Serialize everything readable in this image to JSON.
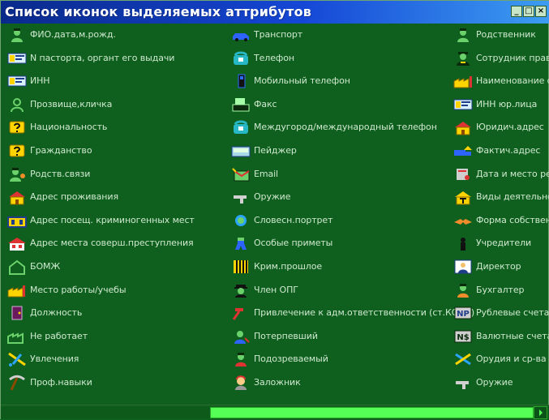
{
  "window": {
    "title": "Список иконок выделяемых аттрибутов",
    "buttons": {
      "minimize": "_",
      "maximize": "□",
      "close": "×"
    }
  },
  "columns": [
    {
      "items": [
        {
          "label": "ФИО.дата,м.рожд.",
          "icon": "person-icon"
        },
        {
          "label": "N пастopта, оргaнт его выдачи",
          "icon": "id-card-icon"
        },
        {
          "label": "ИНН",
          "icon": "id-card-icon"
        },
        {
          "label": "Прозвище,кличка",
          "icon": "person-outline-icon"
        },
        {
          "label": "Национальность",
          "icon": "question-icon"
        },
        {
          "label": "Гражданство",
          "icon": "question-icon"
        },
        {
          "label": "Родств.связи",
          "icon": "relative-icon"
        },
        {
          "label": "Адрес проживания",
          "icon": "house-icon"
        },
        {
          "label": "Адрес посещ. криминогенных мест",
          "icon": "building-icon"
        },
        {
          "label": "Адрес места соверш.преступления",
          "icon": "crime-house-icon"
        },
        {
          "label": "БОМЖ",
          "icon": "empty-house-icon"
        },
        {
          "label": "Место работы/учебы",
          "icon": "factory-icon"
        },
        {
          "label": "Должность",
          "icon": "door-icon"
        },
        {
          "label": "Не работает",
          "icon": "factory-outline-icon"
        },
        {
          "label": "Увлечения",
          "icon": "hobby-icon"
        },
        {
          "label": "Проф.навыки",
          "icon": "pickaxe-icon"
        }
      ]
    },
    {
      "items": [
        {
          "label": "Транспорт",
          "icon": "car-icon"
        },
        {
          "label": "Телефон",
          "icon": "phone-icon"
        },
        {
          "label": "Мобильный телефон",
          "icon": "mobile-phone-icon"
        },
        {
          "label": "Факс",
          "icon": "fax-icon"
        },
        {
          "label": "Междугород/международный телефон",
          "icon": "intl-phone-icon"
        },
        {
          "label": "Пейджер",
          "icon": "pager-icon"
        },
        {
          "label": "Email",
          "icon": "email-icon"
        },
        {
          "label": "Оружие",
          "icon": "gun-icon"
        },
        {
          "label": "Словесн.портрет",
          "icon": "portrait-icon"
        },
        {
          "label": "Особые приметы",
          "icon": "body-marks-icon"
        },
        {
          "label": "Крим.прошлое",
          "icon": "prison-bars-icon"
        },
        {
          "label": "Член ОПГ",
          "icon": "gangster-icon"
        },
        {
          "label": "Привлечение к адм.ответственности (ст.КОАП)",
          "icon": "hammer-icon"
        },
        {
          "label": "Потерпевший",
          "icon": "victim-icon"
        },
        {
          "label": "Подозреваемый",
          "icon": "suspect-icon"
        },
        {
          "label": "Заложник",
          "icon": "hostage-icon"
        }
      ]
    },
    {
      "items": [
        {
          "label": "Родственник",
          "icon": "person-icon"
        },
        {
          "label": "Сотрудник правоохр",
          "icon": "officer-icon"
        },
        {
          "label": "Наименование орга",
          "icon": "organization-icon"
        },
        {
          "label": "ИНН юр.лица",
          "icon": "id-card-icon"
        },
        {
          "label": "Юридич.адрес",
          "icon": "house-icon"
        },
        {
          "label": "Фактич.адрес",
          "icon": "truck-house-icon"
        },
        {
          "label": "Дата и место регис",
          "icon": "registration-icon"
        },
        {
          "label": "Виды деятельности",
          "icon": "activity-icon"
        },
        {
          "label": "Форма собственно",
          "icon": "handshake-icon"
        },
        {
          "label": "Учредители",
          "icon": "founder-icon"
        },
        {
          "label": "Директор",
          "icon": "director-icon"
        },
        {
          "label": "Бухгалтер",
          "icon": "accountant-icon"
        },
        {
          "label": "Рублевые счета",
          "icon": "ruble-account-icon"
        },
        {
          "label": "Валютные счета",
          "icon": "currency-account-icon"
        },
        {
          "label": "Орудия и ср-ва сове",
          "icon": "tools-icon"
        },
        {
          "label": "Оружие",
          "icon": "gun-icon"
        }
      ]
    }
  ],
  "colors": {
    "background": "#0f5f1f",
    "title_bar_start": "#0a2a8a",
    "title_bar_end": "#3d9df2",
    "text": "#cfe9cf",
    "scroll_thumb": "#55ff55"
  }
}
